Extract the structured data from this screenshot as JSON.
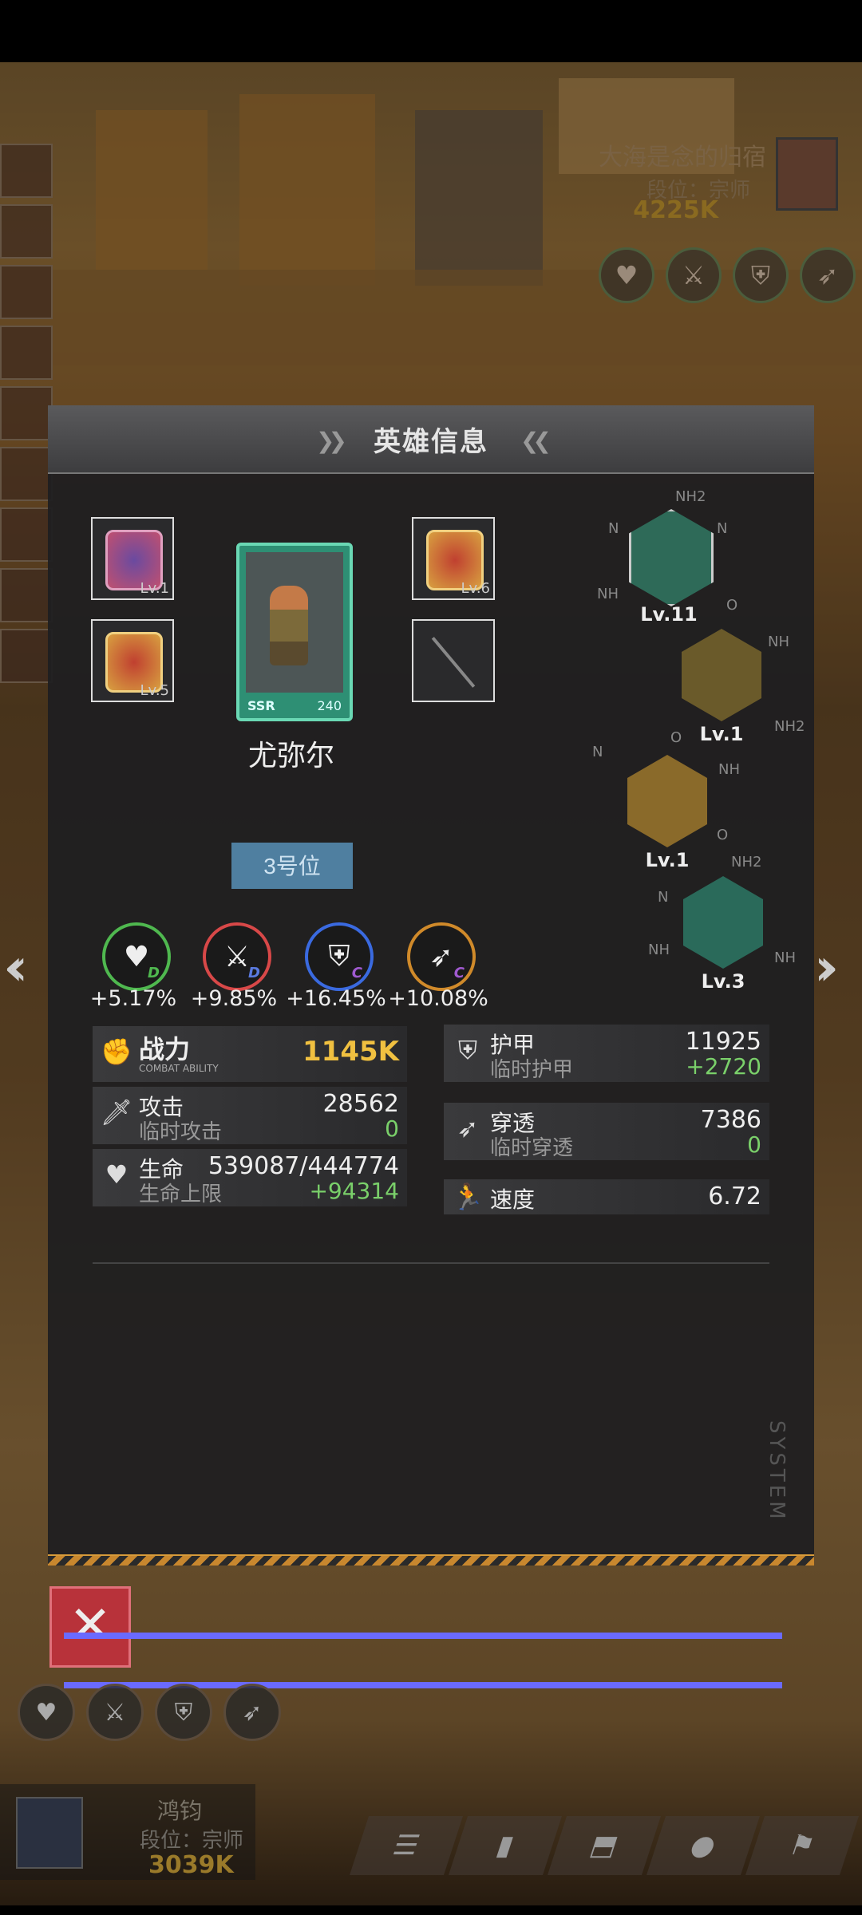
{
  "opponent": {
    "name": "大海是念的归宿",
    "rank": "段位：宗师",
    "power": "4225K"
  },
  "panel": {
    "title": "英雄信息"
  },
  "equipment": {
    "slot1_level": "Lv.1",
    "slot2_level": "Lv.5",
    "slot3_level": "Lv.6"
  },
  "hero": {
    "name": "尤弥尔",
    "rarity": "SSR",
    "card_level": "240",
    "position_label": "3号位"
  },
  "genes": [
    {
      "level": "Lv.11"
    },
    {
      "level": "Lv.1"
    },
    {
      "level": "Lv.1"
    },
    {
      "level": "Lv.3"
    }
  ],
  "chem_labels": {
    "nh2": "NH2",
    "nh": "NH",
    "n": "N",
    "o": "O"
  },
  "bonuses": [
    {
      "icon": "heart-icon",
      "grade": "D",
      "value": "+5.17%",
      "color": "#4fb84f"
    },
    {
      "icon": "sword-icon",
      "grade": "D",
      "value": "+9.85%",
      "color": "#d84848"
    },
    {
      "icon": "shield-icon",
      "grade": "C",
      "value": "+16.45%",
      "color": "#3a6ae0"
    },
    {
      "icon": "spear-icon",
      "grade": "C",
      "value": "+10.08%",
      "color": "#d08a2a"
    }
  ],
  "stats": {
    "combat": {
      "label": "战力",
      "sub": "COMBAT ABILITY",
      "value": "1145K"
    },
    "attack": {
      "label": "攻击",
      "sub": "临时攻击",
      "value": "28562",
      "extra": "0"
    },
    "hp": {
      "label": "生命",
      "sub": "生命上限",
      "value": "539087/444774",
      "extra": "+94314"
    },
    "armor": {
      "label": "护甲",
      "sub": "临时护甲",
      "value": "11925",
      "extra": "+2720"
    },
    "pierce": {
      "label": "穿透",
      "sub": "临时穿透",
      "value": "7386",
      "extra": "0"
    },
    "speed": {
      "label": "速度",
      "value": "6.72"
    }
  },
  "watermark": "SYSTEM",
  "player": {
    "name": "鸿钧",
    "rank": "段位：宗师",
    "power": "3039K"
  }
}
